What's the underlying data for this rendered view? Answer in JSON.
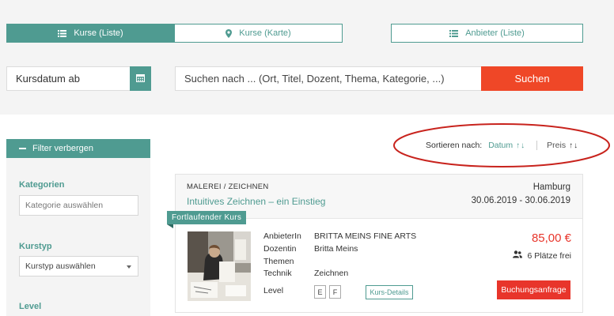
{
  "views": {
    "list": {
      "label": "Kurse (Liste)",
      "icon": "list-icon"
    },
    "map": {
      "label": "Kurse (Karte)",
      "icon": "map-pin-icon"
    },
    "providers": {
      "label": "Anbieter (Liste)",
      "icon": "list-icon"
    }
  },
  "search": {
    "date_placeholder": "Kursdatum ab",
    "query_placeholder": "Suchen nach ... (Ort, Titel, Dozent, Thema, Kategorie, ...)",
    "button_label": "Suchen",
    "calendar_icon": "calendar-icon"
  },
  "sidebar": {
    "toggle_label": "Filter verbergen",
    "categories_label": "Kategorien",
    "categories_placeholder": "Kategorie auswählen",
    "coursetype_label": "Kurstyp",
    "coursetype_value": "Kurstyp auswählen",
    "level_label": "Level"
  },
  "sort": {
    "label": "Sortieren nach:",
    "date_option": "Datum",
    "price_option": "Preis",
    "arrows": "↑↓"
  },
  "course": {
    "category": "MALEREI / ZEICHNEN",
    "title": "Intuitives Zeichnen – ein Einstieg",
    "city": "Hamburg",
    "dates": "30.06.2019 - 30.06.2019",
    "ribbon": "Fortlaufender Kurs",
    "details": [
      {
        "key": "AnbieterIn",
        "value": "BRITTA MEINS FINE ARTS"
      },
      {
        "key": "Dozentin",
        "value": "Britta Meins"
      },
      {
        "key": "Themen",
        "value": ""
      },
      {
        "key": "Technik",
        "value": "Zeichnen"
      },
      {
        "key": "Level",
        "value": ""
      }
    ],
    "levels": [
      "E",
      "F"
    ],
    "details_button": "Kurs-Details",
    "price": "85,00 €",
    "spots": "6 Plätze frei",
    "book_button": "Buchungsanfrage"
  },
  "colors": {
    "accent": "#4f9b91",
    "cta": "#ef4727",
    "price": "#e8352b",
    "highlight_ellipse": "#c8231d"
  }
}
